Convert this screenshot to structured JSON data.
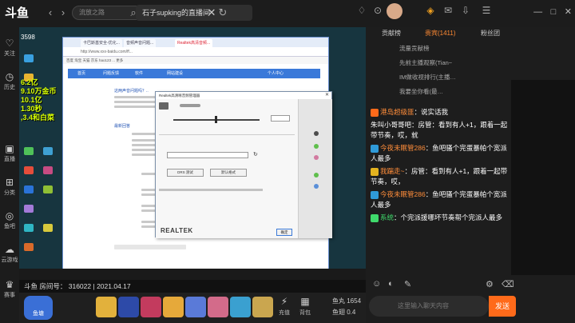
{
  "app": {
    "logo": "斗鱼"
  },
  "topbar": {
    "search_placeholder": "流放之路",
    "room_tab": "石子supking的直播间",
    "username": ""
  },
  "leftbar": [
    {
      "label": "关注",
      "icon": "heart-icon"
    },
    {
      "label": "历史",
      "icon": "history-icon"
    },
    {
      "label": "直播",
      "icon": "live-icon"
    },
    {
      "label": "分类",
      "icon": "category-icon"
    },
    {
      "label": "鱼吧",
      "icon": "fishbar-icon"
    },
    {
      "label": "云游戏",
      "icon": "cloud-game-icon"
    },
    {
      "label": "赛事",
      "icon": "match-icon"
    }
  ],
  "stream": {
    "fans_count": "3598",
    "overlay_lines": [
      "6.2亿",
      "9.10万金币",
      "10.1亿",
      "1.30秒",
      ",3.4和白菜"
    ],
    "browser": {
      "tabs": [
        "卡巴斯基安全-优化...",
        "音频声音问题...",
        "Realtek高清音频..."
      ],
      "address": "http://www.xxx-baidu.com/ff...",
      "bookmarks": "百度 淘宝 天猫 京东 hao123 ... 更多",
      "site_nav": [
        "首页",
        "问题反馈",
        "软件",
        "网站建设",
        "个人中心"
      ],
      "article_title": "这两声音问题吗？..",
      "related_title": "最新回答"
    },
    "dialog": {
      "title": "Realtek高清晰音频管理器",
      "brand": "REALTEK",
      "ok_label": "确定",
      "buttons": [
        "DRS 测试",
        "默认格式"
      ]
    }
  },
  "info_strip": {
    "room_id_label": "斗鱼 房间号：",
    "room_id": "316022",
    "date": "2021.04.17"
  },
  "giftbar": {
    "badge": "鱼塘",
    "functions": [
      "充值",
      "背包"
    ],
    "stats": [
      "鱼丸",
      "1654",
      "鱼翅",
      "0.4"
    ]
  },
  "right_panel": {
    "tabs": [
      "贡献榜",
      "贵宾(1411)",
      "粉丝团"
    ],
    "rows": [
      "流量贡献榜",
      "先前主播观察(Tian~",
      "IM做收视排行(主播…",
      "我要坐你看(最…"
    ]
  },
  "chat": [
    {
      "user": "港岛超级匪",
      "text": "说实话我",
      "style": "orange"
    },
    {
      "user": "",
      "text": "朱叫小哥哥吧：房管：看到有人+1，跟着一起带节奏，哎，就",
      "style": "plain"
    },
    {
      "user": "今夜未眠管286",
      "text": "鱼吧骚个完蛋暴帕个宽派人最多",
      "style": "orange"
    },
    {
      "user": "我踹走~",
      "text": "房管：看到有人+1，跟着一起带节奏，哎，",
      "style": "orange"
    },
    {
      "user": "今夜未眠管286",
      "text": "鱼吧骚个完蛋暴帕个宽派人最多",
      "style": "orange"
    },
    {
      "user": "系统",
      "text": "个完派援哪坏节奏帮个完派人最多",
      "style": "green"
    }
  ],
  "chat_input": {
    "placeholder": "这里输入聊天内容",
    "send_label": "发送"
  },
  "colors": {
    "accent": "#ff6a1a",
    "chat_user": "#ff8d3a",
    "dialog_bg": "#ececec"
  }
}
